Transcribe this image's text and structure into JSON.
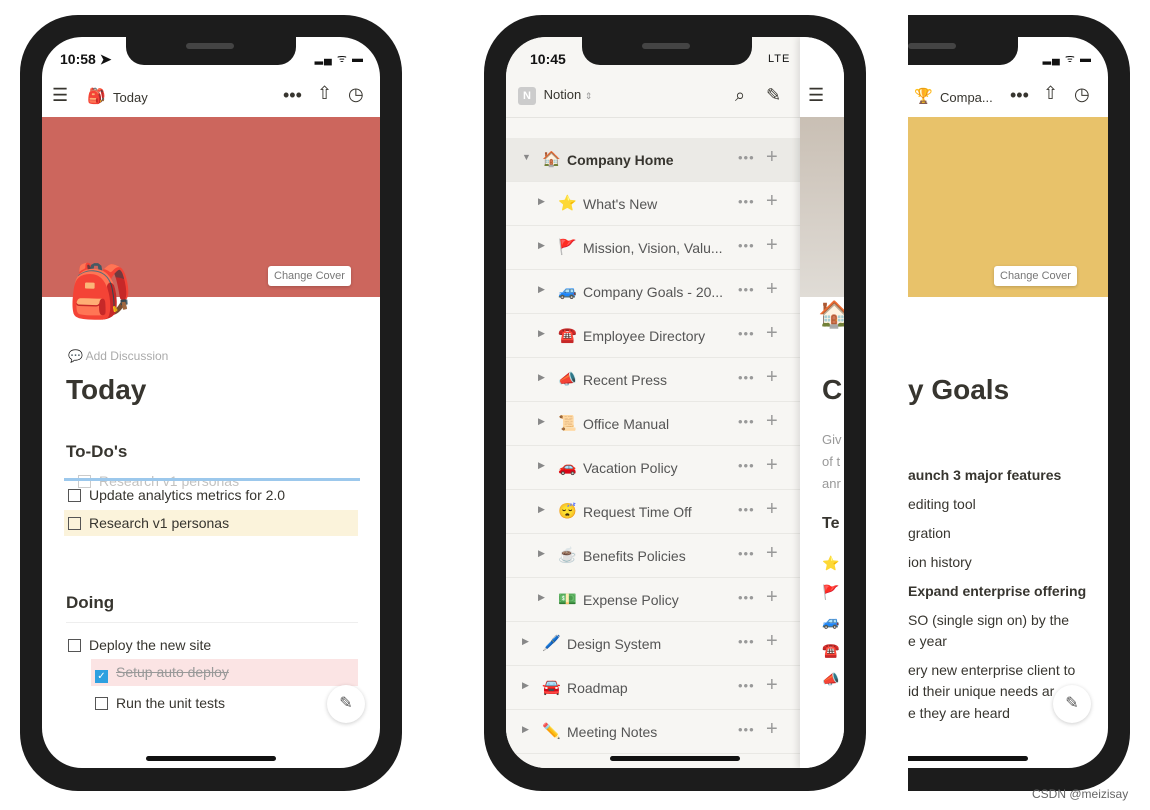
{
  "phone1": {
    "time": "10:58 ➤",
    "header": {
      "page_icon": "backpack",
      "title": "Today"
    },
    "cover_color": "#cc665d",
    "change_cover": "Change Cover",
    "add_discussion": "Add Discussion",
    "title": "Today",
    "sections": [
      {
        "heading": "To-Do's",
        "items": [
          {
            "text": "Research v1 personas",
            "checked": false,
            "dragging": true
          },
          {
            "text": "Update analytics metrics for 2.0",
            "checked": false
          },
          {
            "text": "Research v1 personas",
            "checked": false,
            "highlight": "#fbf3db"
          }
        ]
      },
      {
        "heading": "Doing",
        "items": [
          {
            "text": "Deploy the new site",
            "checked": false
          },
          {
            "text": "Setup auto deploy",
            "checked": true,
            "highlight": "#fbe4e4"
          },
          {
            "text": "Run the unit tests",
            "checked": false
          }
        ]
      }
    ]
  },
  "phone2": {
    "time": "10:45",
    "status": "LTE",
    "workspace": "Notion",
    "workspace_icon": "N",
    "sidebar": [
      {
        "icon": "🏠",
        "label": "Company Home",
        "expanded": true,
        "active": true
      },
      {
        "icon": "⭐",
        "label": "What's New"
      },
      {
        "icon": "🚩",
        "label": "Mission, Vision, Valu..."
      },
      {
        "icon": "🚙",
        "label": "Company Goals - 20..."
      },
      {
        "icon": "☎️",
        "label": "Employee Directory"
      },
      {
        "icon": "📣",
        "label": "Recent Press"
      },
      {
        "icon": "📜",
        "label": "Office Manual"
      },
      {
        "icon": "🚗",
        "label": "Vacation Policy"
      },
      {
        "icon": "😴",
        "label": "Request Time Off"
      },
      {
        "icon": "☕",
        "label": "Benefits Policies"
      },
      {
        "icon": "💵",
        "label": "Expense Policy"
      },
      {
        "icon": "🖊️",
        "label": "Design System"
      },
      {
        "icon": "🚘",
        "label": "Roadmap"
      },
      {
        "icon": "✏️",
        "label": "Meeting Notes"
      }
    ],
    "peek": {
      "title": "C",
      "desc": [
        "Giv",
        "of t",
        "anr"
      ],
      "heading": "Te",
      "icons": [
        "⭐",
        "🚩",
        "🚙",
        "☎️",
        "📣"
      ]
    }
  },
  "phone3": {
    "header": {
      "page_icon": "trophy",
      "title": "Compa..."
    },
    "cover_color": "#e8c26a",
    "change_cover": "Change Cover",
    "title": "y Goals",
    "lines": [
      {
        "text": "aunch 3 major features",
        "bold": true
      },
      {
        "text": "editing tool"
      },
      {
        "text": "gration"
      },
      {
        "text": "ion history"
      },
      {
        "text": "Expand enterprise offering",
        "bold": true
      },
      {
        "text": "SO (single sign on) by the"
      },
      {
        "text": "e year"
      },
      {
        "text": "ery new enterprise client to"
      },
      {
        "text": "id their unique needs ar"
      },
      {
        "text": "e they are heard"
      }
    ]
  },
  "watermark": "CSDN @meizisay"
}
